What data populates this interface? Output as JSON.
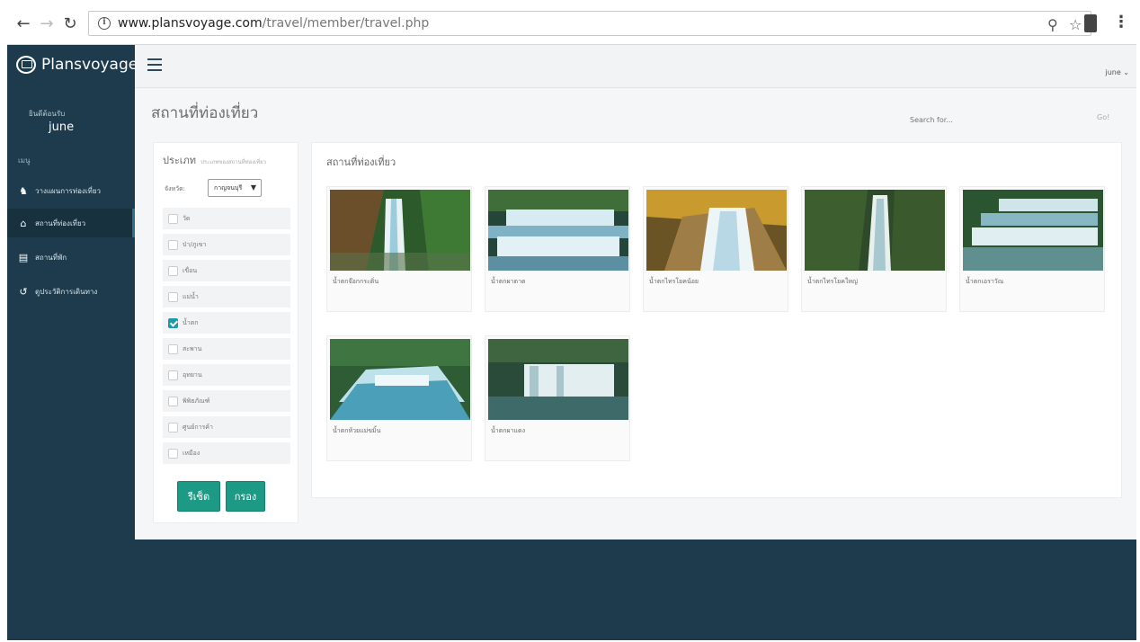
{
  "browser": {
    "url_domain": "www.plansvoyage.com",
    "url_path": "/travel/member/travel.php"
  },
  "app": {
    "brand": "Plansvoyage"
  },
  "sidebar": {
    "welcome_label": "ยินดีต้อนรับ",
    "user_name": "june",
    "menu_heading": "เมนู",
    "items": [
      {
        "label": "วางแผนการท่องเที่ยว",
        "icon": "user-icon"
      },
      {
        "label": "สถานที่ท่องเที่ยว",
        "icon": "home-icon"
      },
      {
        "label": "สถานที่พัก",
        "icon": "bed-icon"
      },
      {
        "label": "ดูประวัติการเดินทาง",
        "icon": "history-icon"
      }
    ]
  },
  "topbar": {
    "user_menu": "june ⌄"
  },
  "main": {
    "page_title": "สถานที่ท่องเที่ยว",
    "search_placeholder": "Search for...",
    "search_button": "Go!"
  },
  "filter": {
    "title": "ประเภท",
    "subtitle": "ประเภทของสถานที่ท่องเที่ยว",
    "province_label": "จังหวัด:",
    "province_value": "กาญจนบุรี",
    "categories": [
      {
        "label": "วัด",
        "checked": false
      },
      {
        "label": "ป่า/ภูเขา",
        "checked": false
      },
      {
        "label": "เขื่อน",
        "checked": false
      },
      {
        "label": "แม่น้ำ",
        "checked": false
      },
      {
        "label": "น้ำตก",
        "checked": true
      },
      {
        "label": "สะพาน",
        "checked": false
      },
      {
        "label": "อุทยาน",
        "checked": false
      },
      {
        "label": "พิพิธภัณฑ์",
        "checked": false
      },
      {
        "label": "ศูนย์การค้า",
        "checked": false
      },
      {
        "label": "เหมือง",
        "checked": false
      }
    ],
    "reset_label": "รีเซ็ต",
    "filter_label": "กรอง"
  },
  "places": {
    "title": "สถานที่ท่องเที่ยว",
    "items": [
      {
        "name": "น้ำตกจ๊อกกระดิ่น"
      },
      {
        "name": "น้ำตกผาตาด"
      },
      {
        "name": "น้ำตกไทรโยคน้อย"
      },
      {
        "name": "น้ำตกไทรโยคใหญ่"
      },
      {
        "name": "น้ำตกเอราวัณ"
      },
      {
        "name": "น้ำตกห้วยแม่ขมิ้น"
      },
      {
        "name": "น้ำตกผาแดง"
      }
    ]
  },
  "colors": {
    "sidebar_bg": "#1d3b4c",
    "accent": "#1d9a86",
    "checkbox_checked": "#1f98a8"
  }
}
